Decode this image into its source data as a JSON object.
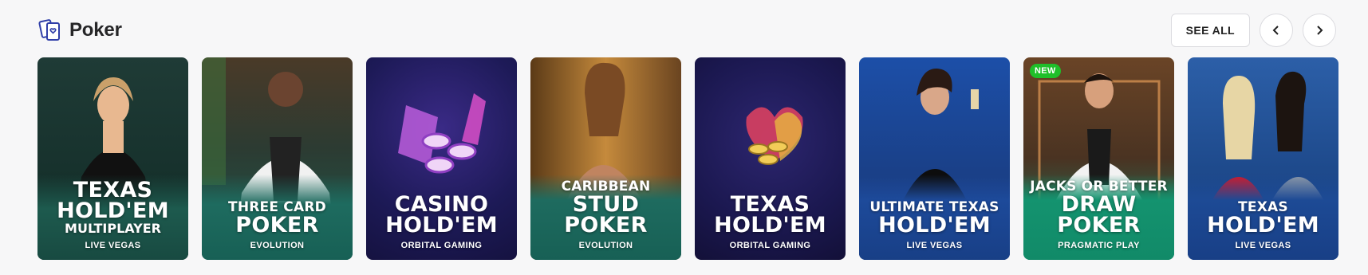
{
  "header": {
    "title": "Poker",
    "see_all_label": "SEE ALL",
    "icon": "cards-icon",
    "prev_icon": "chevron-left-icon",
    "next_icon": "chevron-right-icon"
  },
  "colors": {
    "badge_green": "#1fbf2a",
    "teal_band": "#1e6b5f",
    "navy": "#1c1a55"
  },
  "cards": [
    {
      "l1": "TEXAS",
      "l2": "HOLD'EM",
      "l3": "MULTIPLAYER",
      "provider": "LIVE VEGAS"
    },
    {
      "l1": "THREE CARD",
      "l2": "POKER",
      "provider": "EVOLUTION"
    },
    {
      "l1": "CASINO",
      "l2": "HOLD'EM",
      "provider": "ORBITAL GAMING"
    },
    {
      "l1": "CARIBBEAN",
      "l2": "STUD POKER",
      "provider": "EVOLUTION"
    },
    {
      "l1": "TEXAS",
      "l2": "HOLD'EM",
      "provider": "ORBITAL GAMING"
    },
    {
      "l1": "ULTIMATE TEXAS",
      "l2": "HOLD'EM",
      "provider": "LIVE VEGAS"
    },
    {
      "badge": "NEW",
      "l1": "JACKS OR BETTER",
      "l2": "DRAW POKER",
      "provider": "PRAGMATIC PLAY"
    },
    {
      "l1": "TEXAS",
      "l2": "HOLD'EM",
      "provider": "LIVE VEGAS"
    }
  ]
}
